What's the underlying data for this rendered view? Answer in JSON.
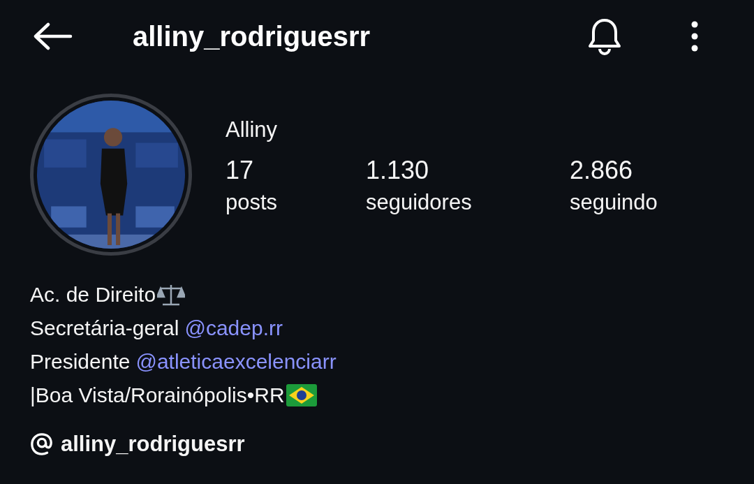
{
  "header": {
    "username": "alliny_rodriguesrr"
  },
  "profile": {
    "name": "Alliny"
  },
  "stats": [
    {
      "value": "17",
      "label": "posts"
    },
    {
      "value": "1.130",
      "label": "seguidores"
    },
    {
      "value": "2.866",
      "label": "seguindo"
    }
  ],
  "bio": [
    {
      "text": "Ac. de Direito"
    },
    {
      "text": "Secretária-geral",
      "mention": "@cadep.rr"
    },
    {
      "text": "Presidente",
      "mention": "@atleticaexcelenciarr"
    },
    {
      "text": "|Boa Vista/Rorainópolis•RR"
    }
  ],
  "threads_link": {
    "username": "alliny_rodriguesrr"
  }
}
